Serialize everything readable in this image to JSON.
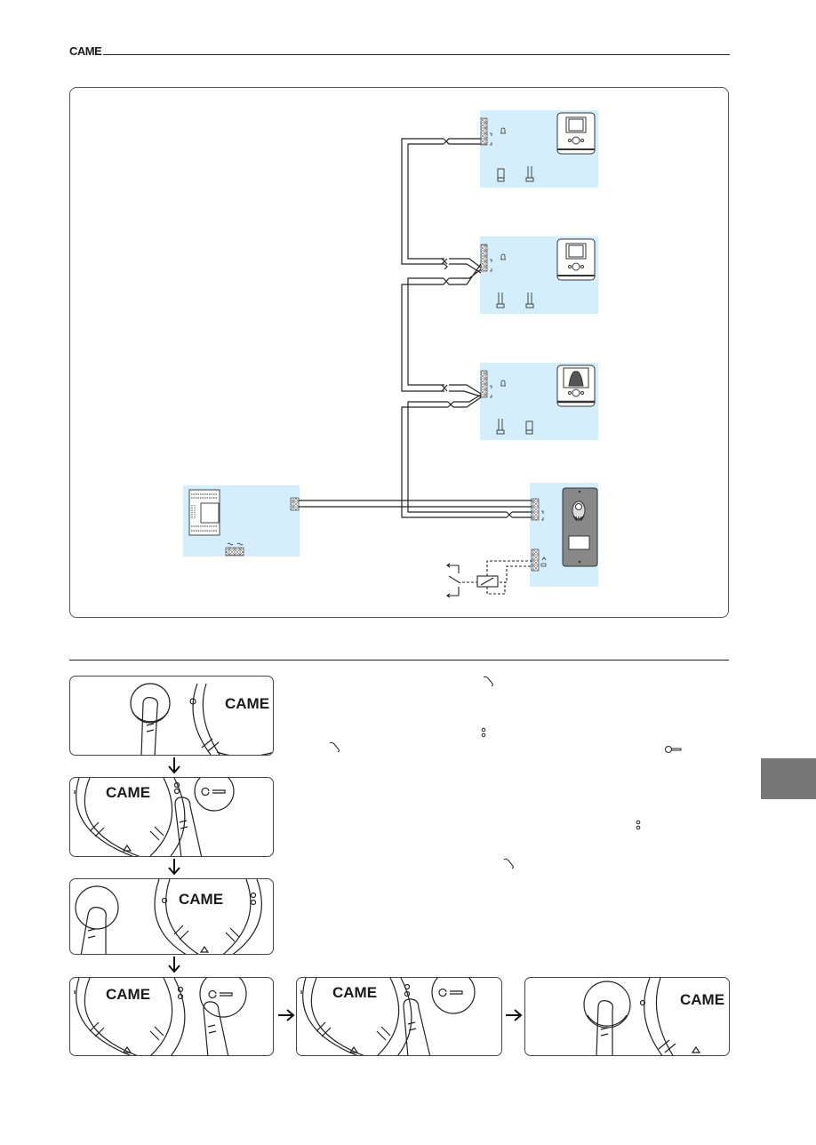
{
  "header": {
    "brand": "CAME"
  },
  "diagram": {
    "units": [
      {
        "name": "monitor-1",
        "type": "monitor-small-screen"
      },
      {
        "name": "monitor-2",
        "type": "monitor-small-screen"
      },
      {
        "name": "monitor-3",
        "type": "video-monitor"
      },
      {
        "name": "entry-panel",
        "type": "door-entry-panel"
      },
      {
        "name": "power-supply",
        "type": "power-supply-din"
      }
    ],
    "symbols": {
      "power": "~",
      "bell": "bell",
      "lock": "lock-release"
    }
  },
  "steps": {
    "panels": [
      {
        "brand_label": "CAME",
        "action": "press-handset-button"
      },
      {
        "brand_label": "CAME",
        "action": "press-menu-button"
      },
      {
        "brand_label": "CAME",
        "action": "press-handset-button"
      },
      {
        "brand_label": "CAME",
        "action": "press-key-button"
      },
      {
        "brand_label": "CAME",
        "action": "press-menu-button"
      },
      {
        "brand_label": "CAME",
        "action": "press-handset-button"
      }
    ]
  },
  "colors": {
    "module_fill": "#d4eefb",
    "line": "#222222",
    "side_tab": "#777777"
  }
}
